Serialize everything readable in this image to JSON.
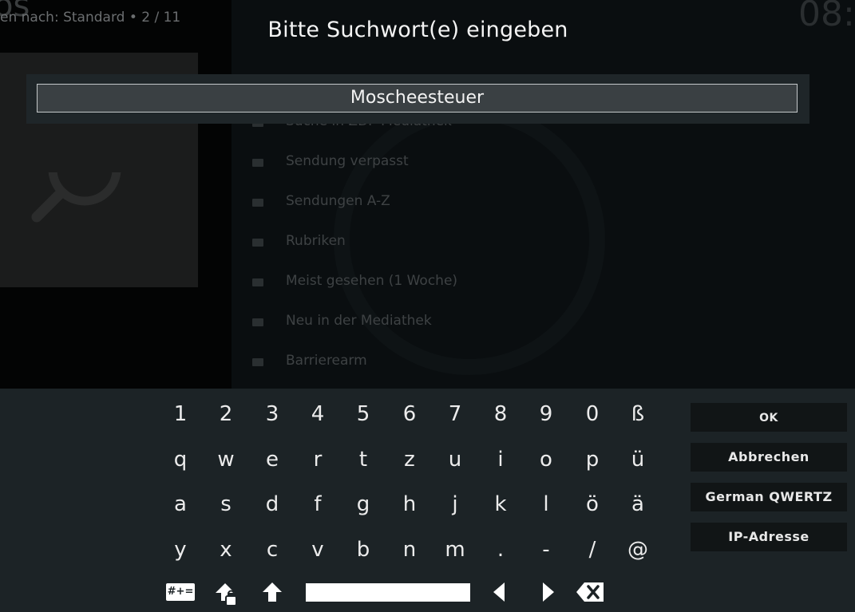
{
  "background": {
    "title_fragment": "os",
    "breadcrumb": "en nach: Standard  •  2 / 11",
    "clock_fragment": "08:",
    "list_items": [
      "Suche in ZDF-Mediathek",
      "Sendung verpasst",
      "Sendungen A-Z",
      "Rubriken",
      "Meist gesehen (1 Woche)",
      "Neu in der Mediathek",
      "Barrierearm"
    ]
  },
  "dialog": {
    "title": "Bitte Suchwort(e) eingeben",
    "input_value": "Moscheesteuer"
  },
  "keyboard": {
    "rows": [
      [
        "1",
        "2",
        "3",
        "4",
        "5",
        "6",
        "7",
        "8",
        "9",
        "0",
        "ß"
      ],
      [
        "q",
        "w",
        "e",
        "r",
        "t",
        "z",
        "u",
        "i",
        "o",
        "p",
        "ü"
      ],
      [
        "a",
        "s",
        "d",
        "f",
        "g",
        "h",
        "j",
        "k",
        "l",
        "ö",
        "ä"
      ],
      [
        "y",
        "x",
        "c",
        "v",
        "b",
        "n",
        "m",
        ".",
        "-",
        "/",
        "@"
      ]
    ],
    "symbols_label": "#+=",
    "side_buttons": {
      "ok": "OK",
      "cancel": "Abbrechen",
      "layout": "German QWERTZ",
      "ip": "IP-Adresse"
    }
  },
  "icons": [
    "search-icon",
    "folder-icon",
    "caps-lock-icon",
    "shift-icon",
    "arrow-left-icon",
    "arrow-right-icon",
    "backspace-icon"
  ],
  "colors": {
    "keyboard_bg": "#1c2326",
    "button_bg": "#111516",
    "input_bg": "#3a4043"
  }
}
